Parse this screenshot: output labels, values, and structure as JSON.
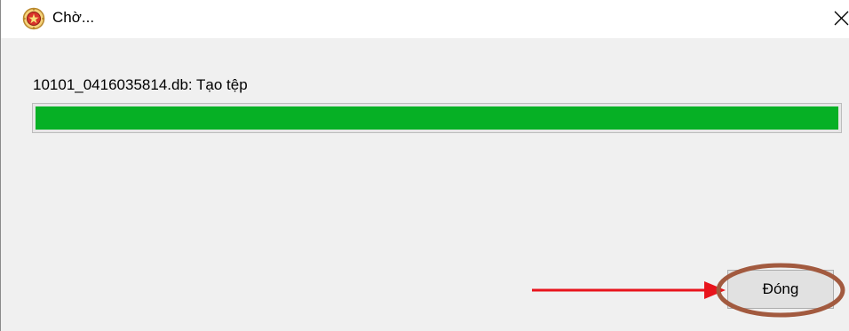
{
  "window": {
    "title": "Chờ...",
    "icon": "app-emblem-icon",
    "close_glyph": "✕"
  },
  "task": {
    "status_text": "10101_0416035814.db: Tạo tệp",
    "progress_percent": 100
  },
  "footer": {
    "close_button_label": "Đóng"
  },
  "colors": {
    "progress_fill": "#06b025",
    "annotation_arrow": "#e8141c",
    "annotation_circle": "#a25a3f"
  }
}
